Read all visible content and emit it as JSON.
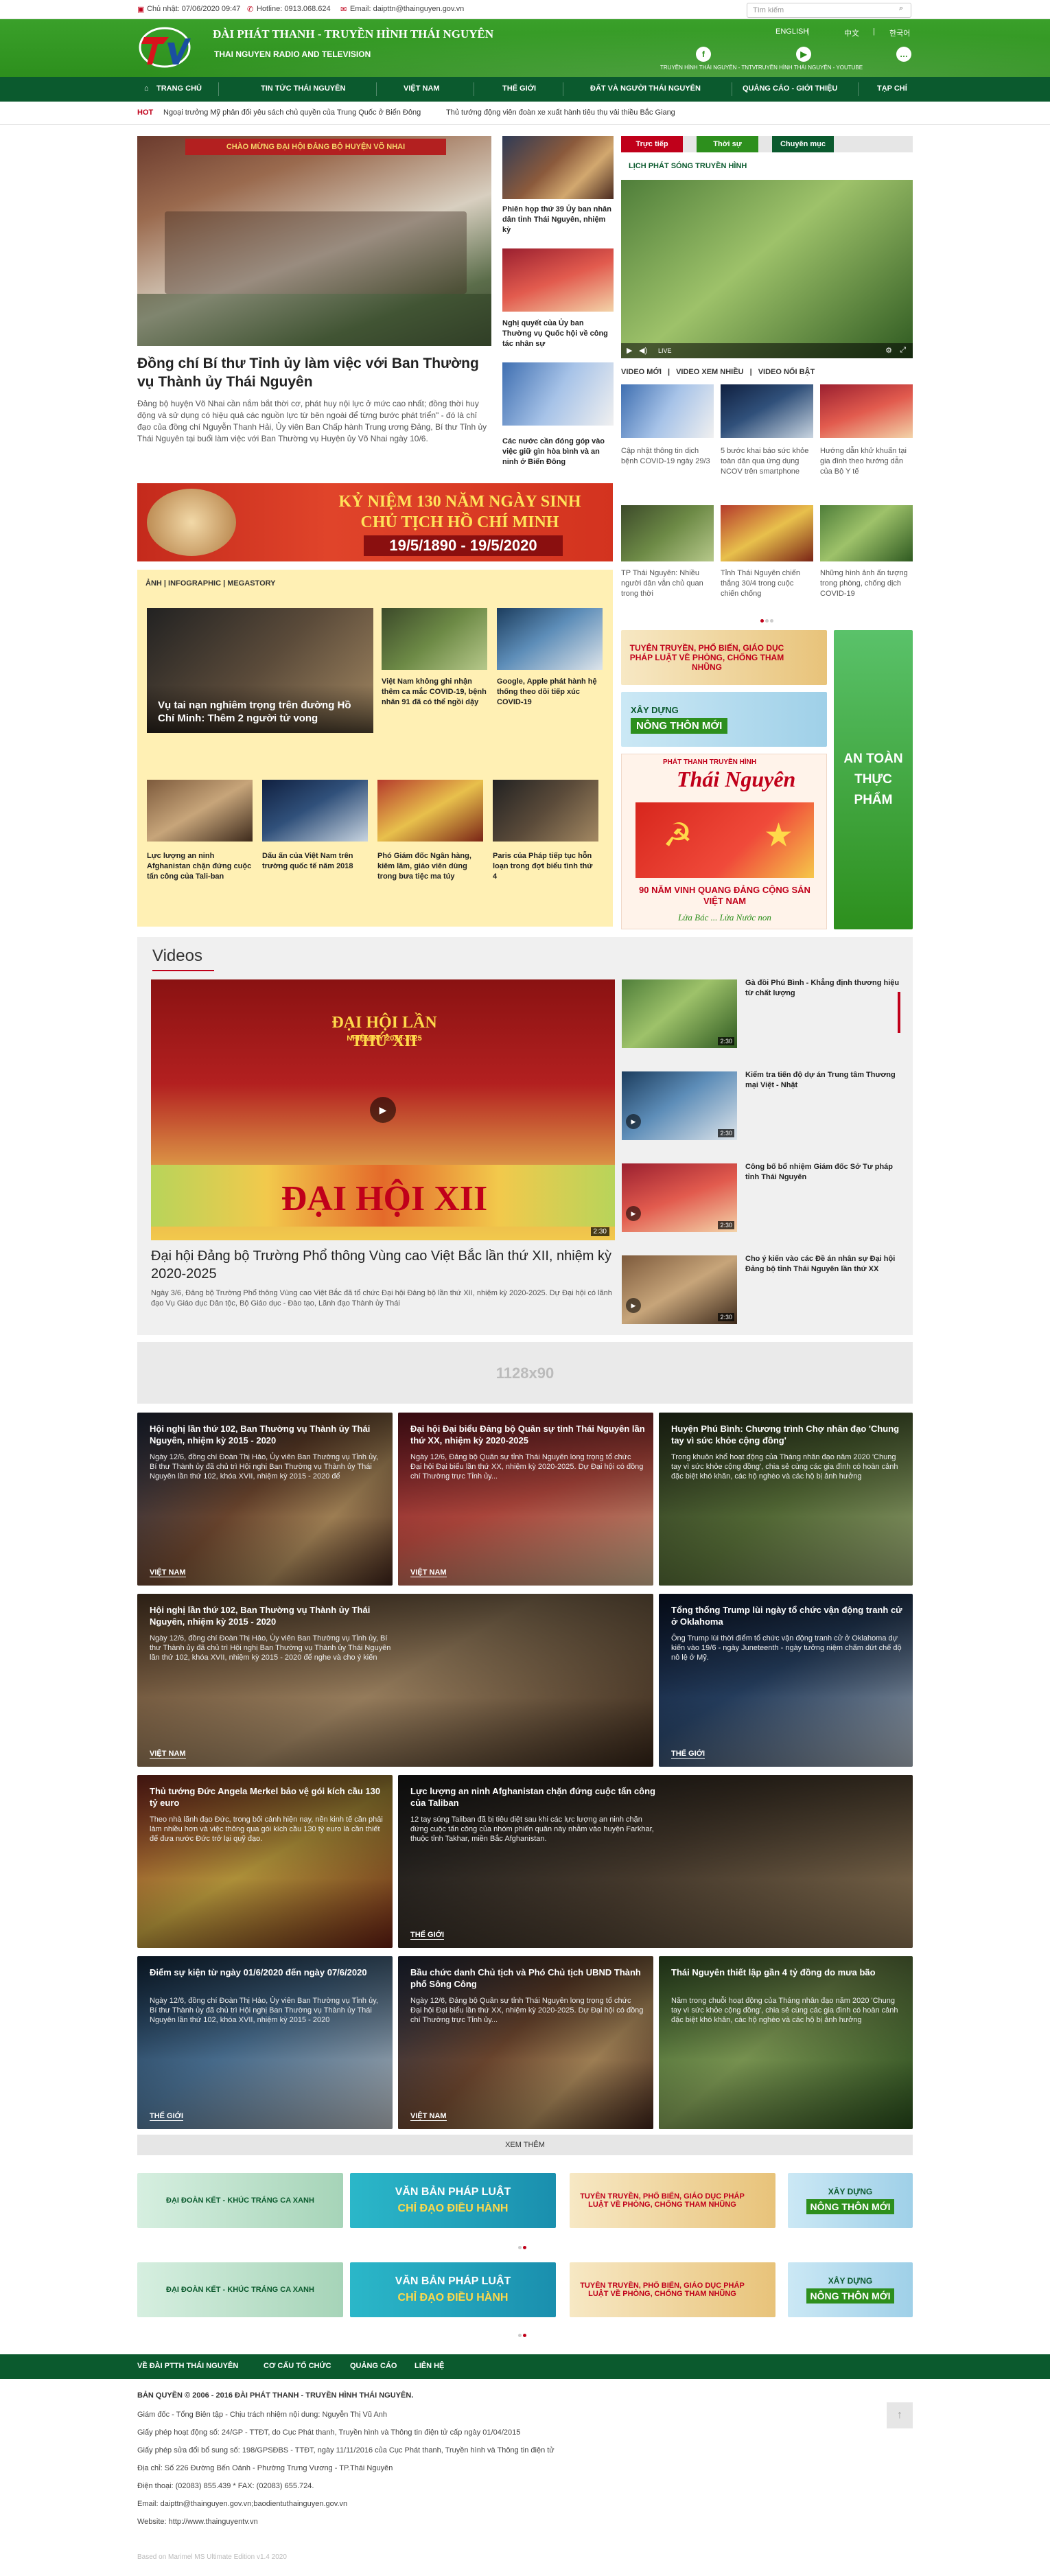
{
  "topbar": {
    "date": "Chủ nhật: 07/06/2020 09:47",
    "hotline": "Hotline: 0913.068.624",
    "email": "Email: daipttn@thainguyen.gov.vn",
    "search_placeholder": "Tìm kiếm"
  },
  "header": {
    "brand_line1": "ĐÀI PHÁT THANH - TRUYỀN HÌNH THÁI NGUYÊN",
    "brand_line2": "THAI NGUYEN RADIO AND TELEVISION",
    "langs": [
      "ENGLISH",
      "|",
      "中文",
      "|",
      "한국어"
    ],
    "social": [
      {
        "icon": "facebook-icon",
        "glyph": "f",
        "label": "TRUYỀN HÌNH THÁI NGUYÊN - TNTV"
      },
      {
        "icon": "youtube-icon",
        "glyph": "▶",
        "label": "TRUYỀN HÌNH THÁI NGUYÊN - YOUTUBE"
      },
      {
        "icon": "chat-icon",
        "glyph": "…",
        "label": ""
      }
    ]
  },
  "nav": {
    "items": [
      "TRANG CHỦ",
      "TIN TỨC THÁI NGUYÊN",
      "VIỆT NAM",
      "THẾ GIỚI",
      "ĐẤT VÀ NGƯỜI THÁI NGUYÊN",
      "QUẢNG CÁO - GIỚI THIỆU",
      "TẠP CHÍ"
    ]
  },
  "ticker": {
    "label": "HOT",
    "items": [
      "Ngoại trưởng Mỹ phản đối yêu sách chủ quyền của Trung Quốc ở Biển Đông",
      "Thủ tướng động viên đoàn xe xuất hành tiêu thụ vải thiều Bắc Giang"
    ]
  },
  "featured": {
    "title": "Đồng chí Bí thư Tỉnh ủy làm việc với Ban Thường vụ Thành ủy Thái Nguyên",
    "desc": "Đảng bộ huyện Võ Nhai cần nắm bắt thời cơ, phát huy nội lực ở mức cao nhất; đồng thời huy động và sử dụng có hiệu quả các nguồn lực từ bên ngoài để từng bước phát triển\" - đó là chỉ đạo của đồng chí Nguyễn Thanh Hải, Ủy viên Ban Chấp hành Trung ương Đảng, Bí thư Tỉnh ủy Thái Nguyên tại buổi làm việc với Ban Thường vụ Huyện ủy Võ Nhai ngày 10/6.",
    "photo_banner": "CHÀO MỪNG ĐẠI HỘI ĐẢNG BỘ HUYỆN VÕ NHAI"
  },
  "side_news": [
    "Phiên họp thứ 39 Ủy ban nhân dân tỉnh Thái Nguyên, nhiệm kỳ",
    "Nghị quyết của Ủy ban Thường vụ Quốc hội về công tác nhân sự",
    "Các nước cần đóng góp vào việc giữ gìn hòa bình và an ninh ở Biển Đông"
  ],
  "hcm_banner": {
    "line1": "KỶ NIỆM 130 NĂM NGÀY SINH",
    "line2": "CHỦ TỊCH HỒ CHÍ MINH",
    "dates": "19/5/1890 - 19/5/2020"
  },
  "infographic": {
    "header": "ẢNH | INFOGRAPHIC | MEGASTORY",
    "main_title": "Vụ tai nạn nghiêm trọng trên đường Hồ Chí Minh: Thêm 2 người tử vong",
    "items": [
      "Việt Nam không ghi nhận thêm ca mắc COVID-19, bệnh nhân 91 đã có thể ngồi dậy",
      "Google, Apple phát hành hệ thống theo dõi tiếp xúc COVID-19",
      "Lực lượng an ninh Afghanistan chặn đứng cuộc tấn công của Tali-ban",
      "Dấu ấn của Việt Nam trên trường quốc tế năm 2018",
      "Phó Giám đốc Ngân hàng, kiêm lãm, giáo viên dùng trong bưa tiệc ma túy",
      "Paris của Pháp tiếp tục hỗn loạn trong đợt biểu tình thứ 4"
    ]
  },
  "live": {
    "tabs": [
      "Trực tiếp",
      "Thời sự",
      "Chuyên mục"
    ],
    "schedule_label": "LỊCH PHÁT SÓNG TRUYỀN HÌNH",
    "player_live": "LIVE",
    "video_tabs": [
      "VIDEO MỚI",
      "|",
      "VIDEO XEM NHIỀU",
      "|",
      "VIDEO NỔI BẬT"
    ],
    "videos": [
      "Cập nhật thông tin dịch bệnh COVID-19 ngày 29/3",
      "5 bước khai báo sức khỏe toàn dân qua ứng dụng NCOV trên smartphone",
      "Hướng dẫn khử khuẩn tại gia đình theo hướng dẫn của Bộ Y tế",
      "TP Thái Nguyên: Nhiều người dân vẫn chủ quan trong thời",
      "Tỉnh Thái Nguyên chiến thắng 30/4 trong cuộc chiến chống",
      "Những hình ảnh ấn tượng trong phòng, chống dịch COVID-19"
    ]
  },
  "right_banners": {
    "propaganda": "TUYÊN TRUYỀN, PHỔ BIẾN, GIÁO DỤC PHÁP LUẬT VỀ PHÒNG, CHỐNG THAM NHŨNG",
    "ntm_top": "XÂY DỰNG",
    "ntm_bottom": "NÔNG THÔN MỚI",
    "food_safety": "AN TOÀN THỰC PHẨM",
    "tn_magazine_top": "PHÁT THANH TRUYỀN HÌNH",
    "tn_magazine_name": "Thái Nguyên",
    "tn_magazine_sub": "90 NĂM VINH QUANG ĐẢNG CỘNG SẢN VIỆT NAM",
    "tn_magazine_slogan": "Lửa Bác ... Lửa Nước non"
  },
  "videos": {
    "section_title": "Videos",
    "main_title": "Đại hội Đảng bộ Trường Phổ thông Vùng cao Việt Bắc lần thứ XII, nhiệm kỳ 2020-2025",
    "main_desc": "Ngày 3/6, Đảng bộ Trường Phổ thông Vùng cao Việt Bắc đã tổ chức Đại hội Đảng bộ lần thứ XII, nhiệm kỳ 2020-2025. Dự Đại hội có lãnh đạo Vụ Giáo dục Dân tộc, Bộ Giáo dục - Đào tạo, Lãnh đạo Thành ủy Thái",
    "main_stage": "ĐẠI HỘI LẦN THỨ XII",
    "main_term": "NHIỆM KỲ 2020-2025",
    "main_flower_text": "ĐẠI HỘI XII",
    "main_duration": "2:30",
    "list": [
      {
        "title": "Gà đồi Phú Bình - Khẳng định thương hiệu từ chất lượng",
        "duration": "2:30"
      },
      {
        "title": "Kiểm tra tiến độ dự án Trung tâm Thương mại Việt - Nhật",
        "duration": "2:30"
      },
      {
        "title": "Công bố bổ nhiệm Giám đốc Sở Tư pháp tỉnh Thái Nguyên",
        "duration": "2:30"
      },
      {
        "title": "Cho ý kiến vào các Đề án nhân sự Đại hội Đảng bộ tỉnh Thái Nguyên lần thứ XX",
        "duration": "2:30"
      }
    ]
  },
  "ad": {
    "size_label": "1128x90"
  },
  "grid": [
    {
      "title": "Hội nghị lần thứ 102, Ban Thường vụ Thành ủy Thái Nguyên, nhiệm kỳ 2015 - 2020",
      "desc": "Ngày 12/6, đồng chí Đoàn Thị Hảo, Ủy viên Ban Thường vụ Tỉnh ủy, Bí thư Thành ủy đã chủ trì Hội nghị Ban Thường vụ Thành ủy Thái Nguyên lần thứ 102, khóa XVII, nhiệm kỳ 2015 - 2020 để",
      "cat": "VIỆT NAM"
    },
    {
      "title": "Đại hội Đại biểu Đảng bộ Quân sự tỉnh Thái Nguyên lần thứ XX, nhiệm kỳ 2020-2025",
      "desc": "Ngày 12/6, Đảng bộ Quân sự tỉnh Thái Nguyên long trọng tổ chức Đại hội Đại biểu lần thứ XX, nhiệm kỳ 2020-2025. Dự Đại hội có đồng chí Thường trực Tỉnh ủy...",
      "cat": "VIỆT NAM"
    },
    {
      "title": "Huyện Phú Bình: Chương trình Chợ nhân đạo 'Chung tay vì sức khỏe cộng đồng'",
      "desc": "Trong khuôn khổ hoạt động của Tháng nhân đạo năm 2020 'Chung tay vì sức khỏe cộng đồng', chia sẻ cùng các gia đình có hoàn cảnh đặc biệt khó khăn, các hộ nghèo và các hộ bị ảnh hưởng",
      "cat": ""
    },
    {
      "title": "Hội nghị lần thứ 102, Ban Thường vụ Thành ủy Thái Nguyên, nhiệm kỳ 2015 - 2020",
      "desc": "Ngày 12/6, đồng chí Đoàn Thị Hảo, Ủy viên Ban Thường vụ Tỉnh ủy, Bí thư Thành ủy đã chủ trì Hội nghị Ban Thường vụ Thành ủy Thái Nguyên lần thứ 102, khóa XVII, nhiệm kỳ 2015 - 2020 để nghe và cho ý kiến",
      "cat": "VIỆT NAM"
    },
    {
      "title": "Tổng thống Trump lùi ngày tổ chức vận động tranh cử ở Oklahoma",
      "desc": "Ông Trump lùi thời điểm tổ chức vận động tranh cử ở Oklahoma dự kiến vào 19/6 - ngày Juneteenth - ngày tưởng niệm chấm dứt chế độ nô lệ ở Mỹ.",
      "cat": "THẾ GIỚI"
    },
    {
      "title": "Thủ tướng Đức Angela Merkel bảo vệ gói kích cầu 130 tỷ euro",
      "desc": "Theo nhà lãnh đạo Đức, trong bối cảnh hiện nay, nền kinh tế cần phải làm nhiều hơn và việc thông qua gói kích cầu 130 tỷ euro là cần thiết để đưa nước Đức trở lại quỹ đạo.",
      "cat": ""
    },
    {
      "title": "Lực lượng an ninh Afghanistan chặn đứng cuộc tấn công của Taliban",
      "desc": "12 tay súng Taliban đã bị tiêu diệt sau khi các lực lượng an ninh chặn đứng cuộc tấn công của nhóm phiến quân này nhằm vào huyện Farkhar, thuộc tỉnh Takhar, miền Bắc Afghanistan.",
      "cat": "THẾ GIỚI"
    },
    {
      "title": "Điểm sự kiện từ ngày 01/6/2020 đến ngày 07/6/2020",
      "desc": "Ngày 12/6, đồng chí Đoàn Thị Hảo, Ủy viên Ban Thường vụ Tỉnh ủy, Bí thư Thành ủy đã chủ trì Hội nghị Ban Thường vụ Thành ủy Thái Nguyên lần thứ 102, khóa XVII, nhiệm kỳ 2015 - 2020",
      "cat": "THẾ GIỚI"
    },
    {
      "title": "Bầu chức danh Chủ tịch và Phó Chủ tịch UBND Thành phố Sông Công",
      "desc": "Ngày 12/6, Đảng bộ Quân sự tỉnh Thái Nguyên long trọng tổ chức Đại hội Đại biểu lần thứ XX, nhiệm kỳ 2020-2025. Dự Đại hội có đồng chí Thường trực Tỉnh ủy...",
      "cat": "VIỆT NAM"
    },
    {
      "title": "Thái Nguyên thiết lập gần 4 tỷ đồng do mưa bão",
      "desc": "Năm trong chuỗi hoạt động của Tháng nhân đạo năm 2020 'Chung tay vì sức khỏe cộng đồng', chia sẻ cùng các gia đình có hoàn cảnh đặc biệt khó khăn, các hộ nghèo và các hộ bị ảnh hưởng",
      "cat": ""
    }
  ],
  "more_label": "XEM THÊM",
  "bottom_banners": {
    "b1": "ĐẠI ĐOÀN KẾT - KHÚC TRÁNG CA XANH",
    "b2_top": "VĂN BẢN PHÁP LUẬT",
    "b2_bottom": "CHỈ ĐẠO ĐIỀU HÀNH",
    "b3": "TUYÊN TRUYỀN, PHỔ BIẾN, GIÁO DỤC PHÁP LUẬT VỀ PHÒNG, CHỐNG THAM NHŨNG",
    "b4_top": "XÂY DỰNG",
    "b4_bottom": "NÔNG THÔN MỚI"
  },
  "footer": {
    "nav": [
      "VỀ ĐÀI PTTH THÁI NGUYÊN",
      "CƠ CẤU TỔ CHỨC",
      "QUẢNG CÁO",
      "LIÊN HỆ"
    ],
    "copyright": "BẢN QUYỀN © 2006 - 2016 ĐÀI PHÁT THANH - TRUYỀN HÌNH THÁI NGUYÊN.",
    "lines": [
      "Giám đốc - Tổng Biên tập - Chịu trách nhiệm nội dung: Nguyễn Thị Vũ Anh",
      "Giấy phép hoạt động số: 24/GP - TTĐT, do Cục Phát thanh, Truyền hình và Thông tin điện tử cấp ngày 01/04/2015",
      "Giấy phép sửa đổi bổ sung số: 198/GPSĐBS - TTĐT, ngày 11/11/2016 của Cục Phát thanh, Truyền hình và Thông tin điện tử",
      "Địa chỉ: Số 226 Đường Bến Oánh - Phường Trưng Vương - TP.Thái Nguyên",
      "Điện thoại: (02083) 855.439 * FAX: (02083) 655.724.",
      "Email: daipttn@thainguyen.gov.vn;baodientuthainguyen.gov.vn",
      "Website: http://www.thainguyentv.vn"
    ],
    "powered": "Based on Marimel MS Ultimate Edition v1.4 2020"
  },
  "colors": {
    "brand_green": "#2d8f1d",
    "nav_green": "#0b5a2e",
    "accent_red": "#c0001a"
  }
}
